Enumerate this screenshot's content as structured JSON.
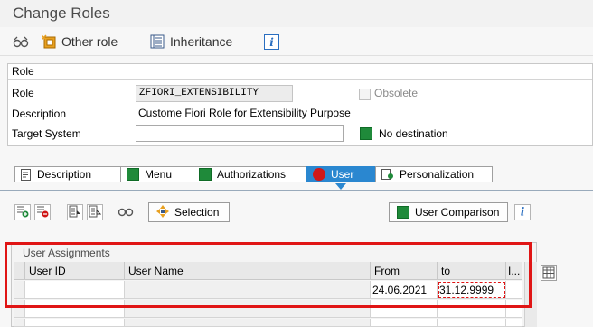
{
  "title": "Change Roles",
  "toolbar": {
    "other_role_label": "Other role",
    "inheritance_label": "Inheritance"
  },
  "role_group": {
    "header": "Role",
    "role_label": "Role",
    "role_value": "ZFIORI_EXTENSIBILITY",
    "obsolete_label": "Obsolete",
    "description_label": "Description",
    "description_value": "Custome Fiori Role for Extensibility Purpose",
    "target_system_label": "Target System",
    "target_system_value": "",
    "no_destination_label": "No destination"
  },
  "tabs": [
    {
      "label": "Description",
      "active": false
    },
    {
      "label": "Menu",
      "active": false
    },
    {
      "label": "Authorizations",
      "active": false
    },
    {
      "label": "User",
      "active": true
    },
    {
      "label": "Personalization",
      "active": false
    }
  ],
  "user_tab": {
    "selection_label": "Selection",
    "user_comparison_label": "User Comparison"
  },
  "assignments": {
    "title": "User Assignments",
    "columns": [
      "User ID",
      "User Name",
      "From",
      "to",
      "I..."
    ],
    "rows": [
      {
        "user_id": "",
        "user_name": "",
        "from": "24.06.2021",
        "to": "31.12.9999"
      }
    ]
  },
  "colors": {
    "green": "#1f8a3a",
    "active_tab": "#2a87d0",
    "highlight": "#e01515"
  }
}
